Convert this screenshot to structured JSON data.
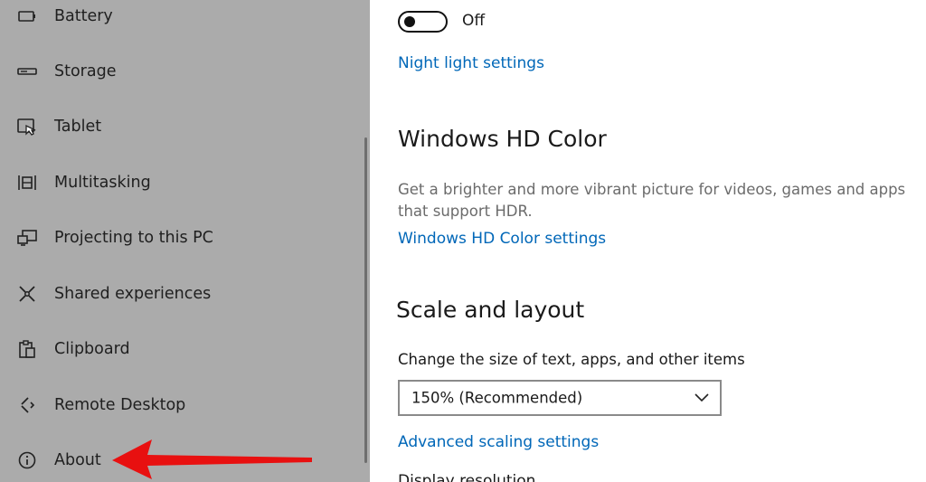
{
  "sidebar": {
    "items": [
      {
        "label": "Battery",
        "icon": "battery-icon"
      },
      {
        "label": "Storage",
        "icon": "storage-icon"
      },
      {
        "label": "Tablet",
        "icon": "tablet-icon"
      },
      {
        "label": "Multitasking",
        "icon": "multitasking-icon"
      },
      {
        "label": "Projecting to this PC",
        "icon": "projecting-icon"
      },
      {
        "label": "Shared experiences",
        "icon": "shared-experiences-icon"
      },
      {
        "label": "Clipboard",
        "icon": "clipboard-icon"
      },
      {
        "label": "Remote Desktop",
        "icon": "remote-desktop-icon"
      },
      {
        "label": "About",
        "icon": "info-icon"
      }
    ]
  },
  "main": {
    "night_light": {
      "toggle_state": "Off",
      "settings_link": "Night light settings"
    },
    "hd_color": {
      "heading": "Windows HD Color",
      "description": "Get a brighter and more vibrant picture for videos, games and apps that support HDR.",
      "settings_link": "Windows HD Color settings"
    },
    "scale_layout": {
      "heading": "Scale and layout",
      "size_label": "Change the size of text, apps, and other items",
      "size_value": "150% (Recommended)",
      "advanced_link": "Advanced scaling settings",
      "next_label_partial": "Display resolution"
    }
  },
  "colors": {
    "sidebar_bg": "#ababab",
    "link": "#0067b8",
    "annotation_arrow": "#e81010"
  }
}
